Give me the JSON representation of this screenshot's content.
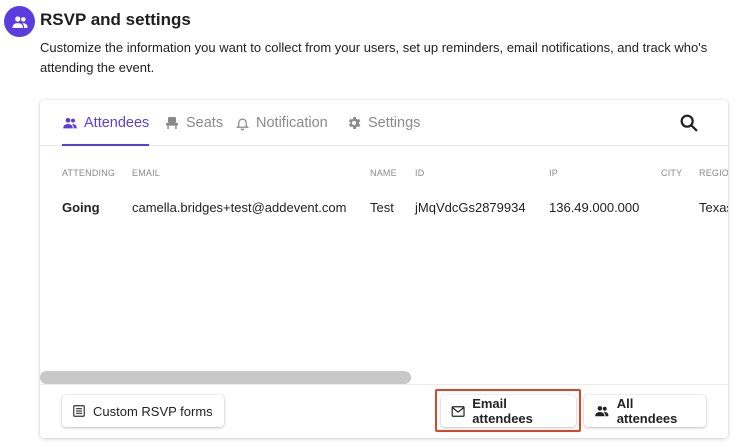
{
  "header": {
    "icon": "people-icon",
    "title": "RSVP and settings",
    "description": "Customize the information you want to collect from your users, set up reminders, email notifications, and track who's attending the event."
  },
  "tabs": [
    {
      "label": "Attendees",
      "icon": "people-icon",
      "active": true
    },
    {
      "label": "Seats",
      "icon": "seat-icon",
      "active": false
    },
    {
      "label": "Notification",
      "icon": "bell-icon",
      "active": false
    },
    {
      "label": "Settings",
      "icon": "gear-icon",
      "active": false
    }
  ],
  "table": {
    "columns": [
      "ATTENDING",
      "EMAIL",
      "NAME",
      "ID",
      "IP",
      "CITY",
      "REGIO"
    ],
    "rows": [
      [
        "Going",
        "camella.bridges+test@addevent.com",
        "Test",
        "jMqVdcGs2879934",
        "136.49.000.000",
        "",
        "Texas"
      ]
    ]
  },
  "footer": {
    "custom_rsvp_label": "Custom RSVP forms",
    "email_attendees_label": "Email attendees",
    "all_attendees_label": "All attendees"
  },
  "colors": {
    "accent": "#5b3ddf",
    "highlight": "#d9452b"
  }
}
